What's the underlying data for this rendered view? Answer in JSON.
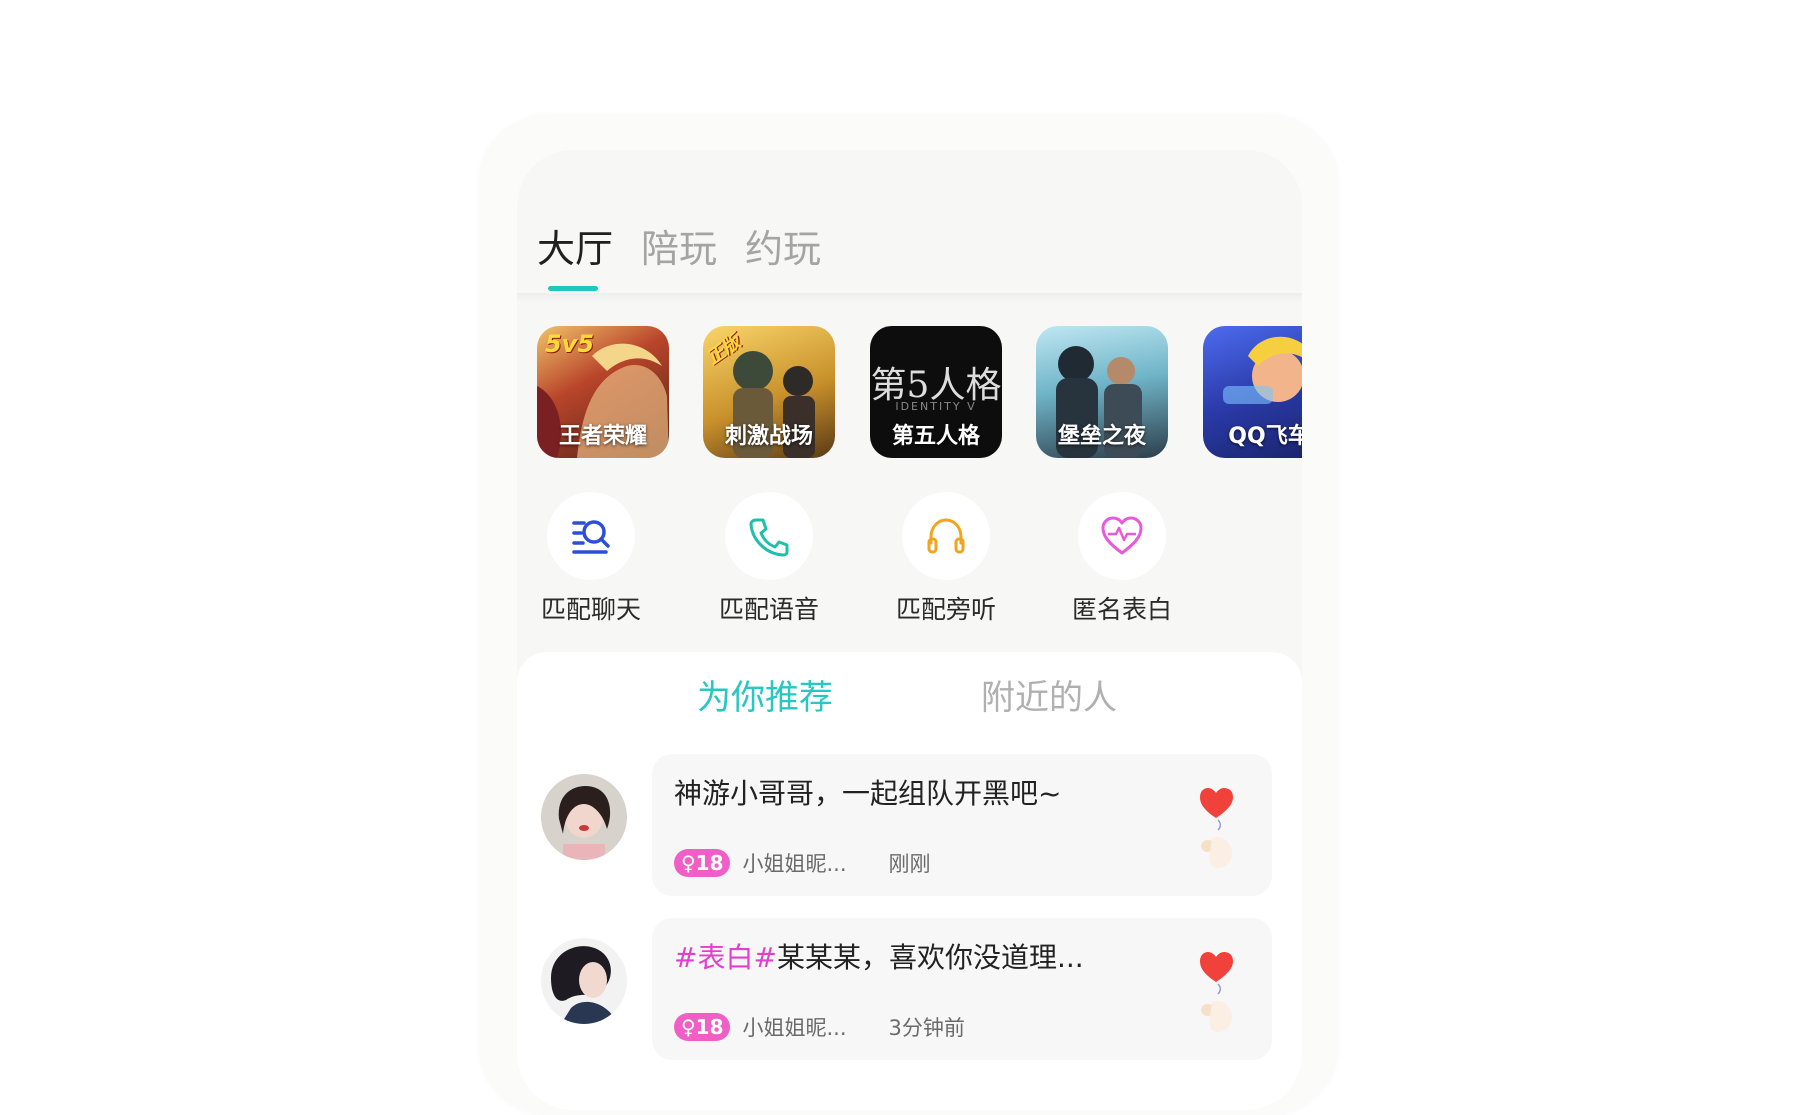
{
  "top_tabs": [
    {
      "label": "大厅",
      "active": true
    },
    {
      "label": "陪玩",
      "active": false
    },
    {
      "label": "约玩",
      "active": false
    }
  ],
  "games": [
    {
      "label": "王者荣耀",
      "badge": "5v5"
    },
    {
      "label": "刺激战场",
      "badge": "正版"
    },
    {
      "label": "第五人格",
      "art_text": "第5人格",
      "art_sub": "IDENTITY V"
    },
    {
      "label": "堡垒之夜"
    },
    {
      "label": "QQ飞车"
    }
  ],
  "features": [
    {
      "label": "匹配聊天",
      "icon": "search-list-icon",
      "color": "#2b4fd8"
    },
    {
      "label": "匹配语音",
      "icon": "phone-icon",
      "color": "#21bfa9"
    },
    {
      "label": "匹配旁听",
      "icon": "headphones-icon",
      "color": "#f2a51c"
    },
    {
      "label": "匿名表白",
      "icon": "heart-pulse-icon",
      "color": "#e85ad9"
    }
  ],
  "feed_tabs": [
    {
      "label": "为你推荐",
      "active": true
    },
    {
      "label": "附近的人",
      "active": false
    }
  ],
  "posts": [
    {
      "tag": "",
      "text": "神游小哥哥，一起组队开黑吧~",
      "age": "♀18",
      "nickname": "小姐姐昵...",
      "time": "刚刚"
    },
    {
      "tag": "#表白#",
      "text": "某某某，喜欢你没道理...",
      "age": "♀18",
      "nickname": "小姐姐昵...",
      "time": "3分钟前"
    }
  ],
  "colors": {
    "accent": "#21c6bf",
    "tag_pink": "#e23fce",
    "age_badge": "#f05fc5",
    "heart": "#f0413a"
  }
}
